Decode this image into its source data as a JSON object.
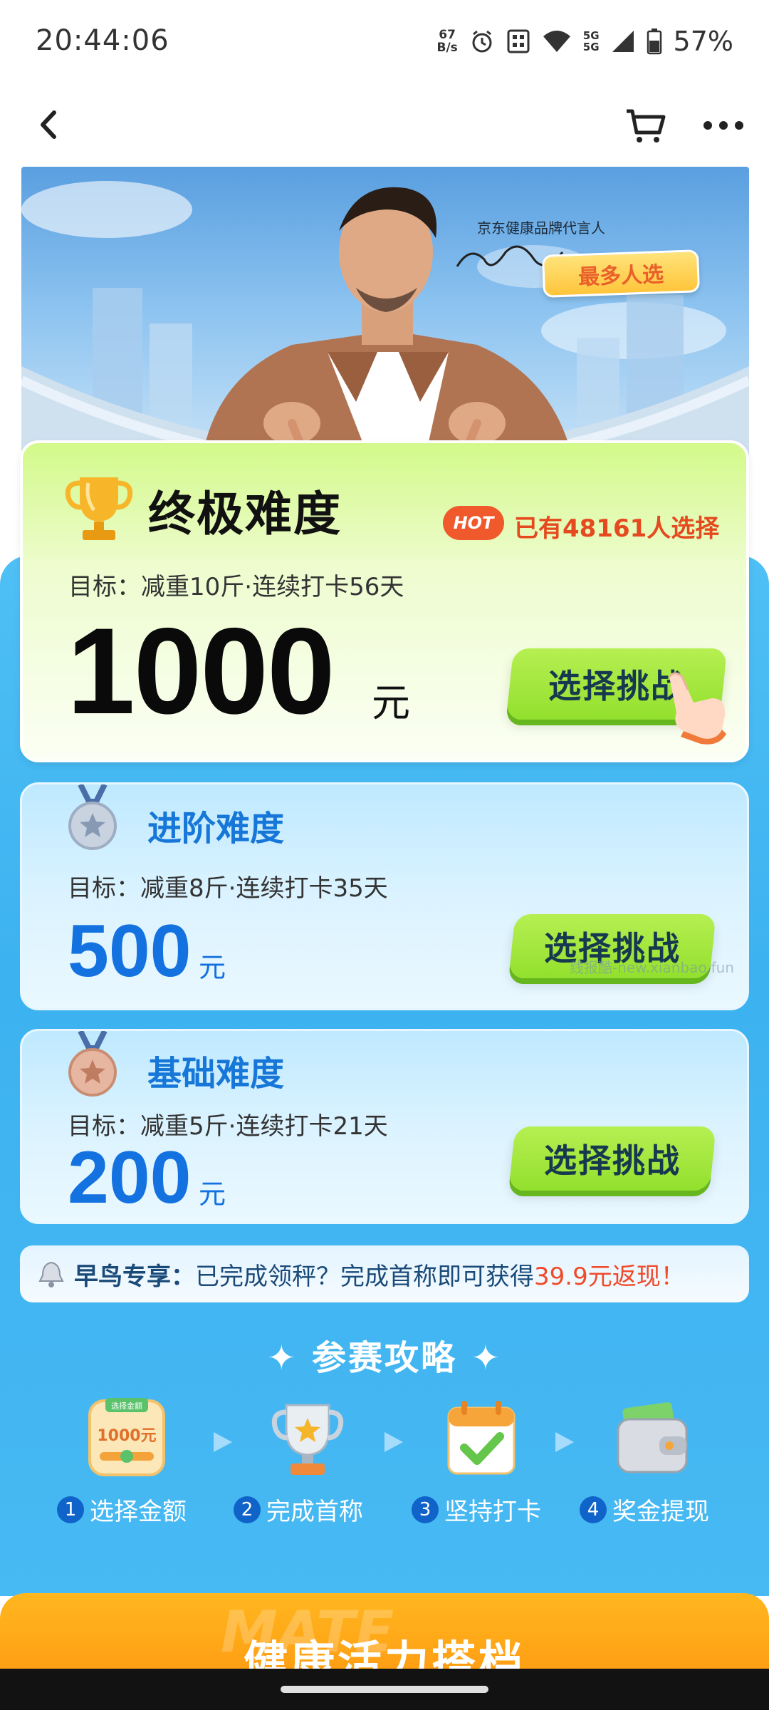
{
  "status_bar": {
    "time": "20:44:06",
    "net_speed_value": "67",
    "net_speed_unit": "B/s",
    "sig_top": "5G",
    "sig_bottom": "5G",
    "battery": "57%"
  },
  "hero": {
    "caption": "京东健康品牌代言人",
    "badge": "最多人选"
  },
  "ultimate": {
    "title": "终极难度",
    "hot": "HOT",
    "chosen": "已有48161人选择",
    "goal": "目标：减重10斤·连续打卡56天",
    "amount": "1000",
    "unit": "元",
    "button": "选择挑战"
  },
  "advanced": {
    "title": "进阶难度",
    "goal": "目标：减重8斤·连续打卡35天",
    "amount": "500",
    "unit": "元",
    "button": "选择挑战"
  },
  "basic": {
    "title": "基础难度",
    "goal": "目标：减重5斤·连续打卡21天",
    "amount": "200",
    "unit": "元",
    "button": "选择挑战"
  },
  "watermark": "线报酷-new.xianbao.fun",
  "early_bird": {
    "label": "早鸟专享：",
    "text": "已完成领秤？完成首称即可获得",
    "highlight": "39.9元返现！"
  },
  "guide": {
    "title": "✦ 参赛攻略 ✦",
    "step1_icon_text": "选择金额",
    "step1_icon_amount": "1000元",
    "steps": [
      {
        "num": "1",
        "label": "选择金额"
      },
      {
        "num": "2",
        "label": "完成首称"
      },
      {
        "num": "3",
        "label": "坚持打卡"
      },
      {
        "num": "4",
        "label": "奖金提现"
      }
    ]
  },
  "bottom_banner": {
    "ghost": "MATE",
    "title": "健康活力搭档"
  },
  "colors": {
    "accent_green": "#93e02d",
    "accent_blue": "#1371e0",
    "hot_orange": "#f0592b",
    "panel_blue": "#3cb2f0"
  }
}
